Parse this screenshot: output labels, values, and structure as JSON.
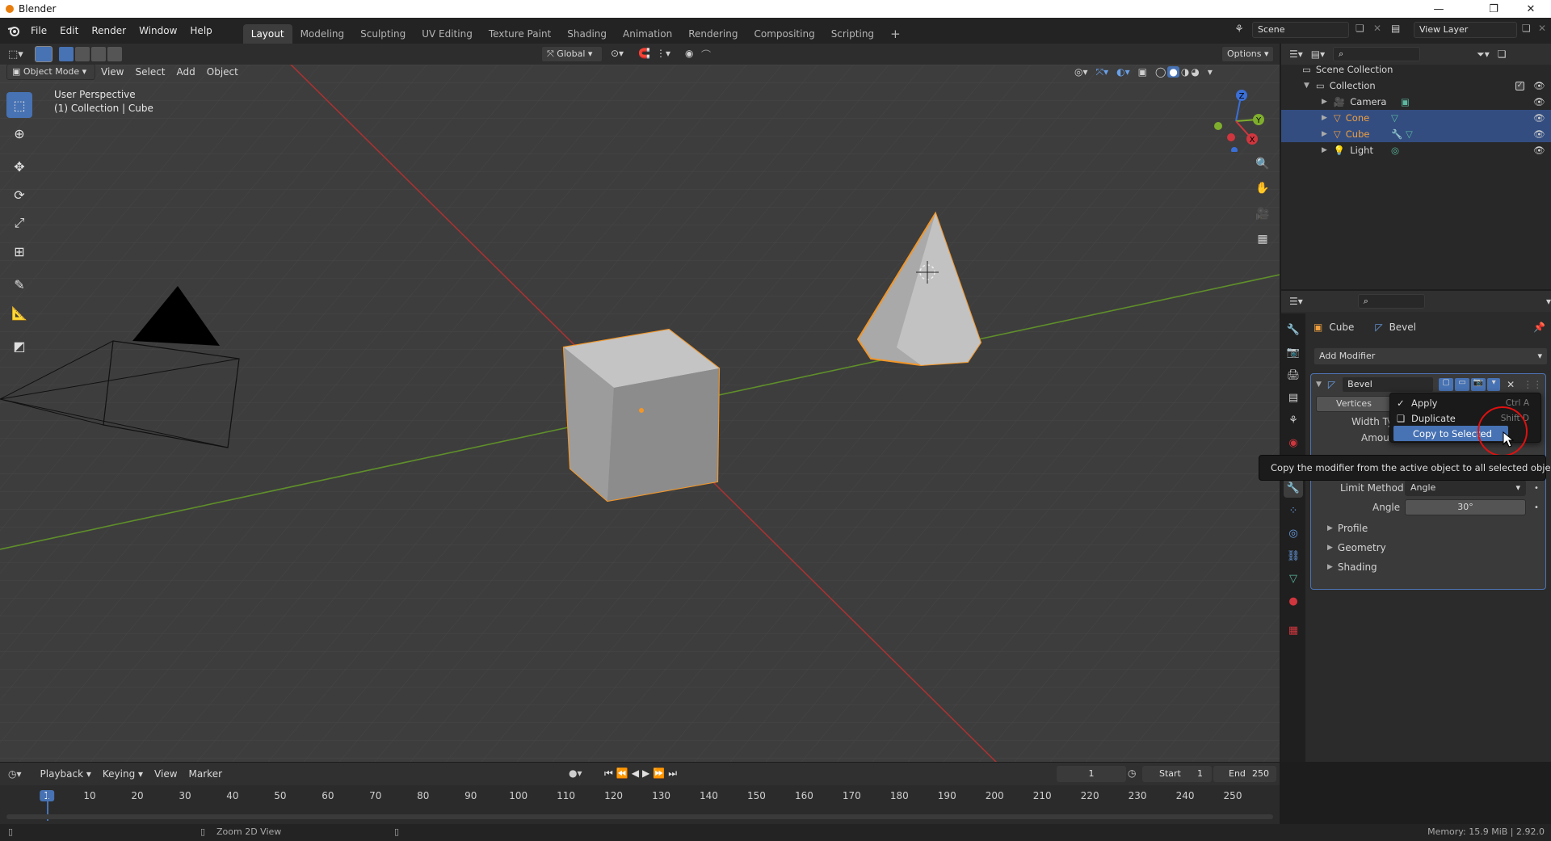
{
  "window": {
    "title": "Blender",
    "minimize": "—",
    "restore": "❐",
    "close": "✕"
  },
  "menus": [
    "File",
    "Edit",
    "Render",
    "Window",
    "Help"
  ],
  "workspaces": {
    "tabs": [
      "Layout",
      "Modeling",
      "Sculpting",
      "UV Editing",
      "Texture Paint",
      "Shading",
      "Animation",
      "Rendering",
      "Compositing",
      "Scripting"
    ],
    "active": "Layout",
    "add_symbol": "+"
  },
  "scene": {
    "name": "Scene",
    "view_layer": "View Layer"
  },
  "viewport_header": {
    "transform_orientation": "Global",
    "options_label": "Options",
    "mode": "Object Mode",
    "menus": [
      "View",
      "Select",
      "Add",
      "Object"
    ]
  },
  "viewport": {
    "perspective_label": "User Perspective",
    "collection_label": "(1) Collection | Cube",
    "gizmo": {
      "x": "X",
      "y": "Y",
      "z": "Z"
    }
  },
  "outliner": {
    "root": "Scene Collection",
    "collection": "Collection",
    "items": [
      {
        "name": "Camera",
        "color": "#d8d8d8",
        "selected": false
      },
      {
        "name": "Cone",
        "color": "#f0a040",
        "selected": true
      },
      {
        "name": "Cube",
        "color": "#f0a040",
        "selected": true
      },
      {
        "name": "Light",
        "color": "#d8d8d8",
        "selected": false
      }
    ]
  },
  "properties": {
    "breadcrumb_object": "Cube",
    "breadcrumb_modifier": "Bevel",
    "add_modifier_label": "Add Modifier",
    "modifier": {
      "name": "Bevel",
      "affect_vertices": "Vertices",
      "width_type_label": "Width Typ",
      "amount_label": "Amoun",
      "limit_method_label": "Limit Method",
      "limit_method_value": "Angle",
      "angle_label": "Angle",
      "angle_value": "30°",
      "subpanels": [
        "Profile",
        "Geometry",
        "Shading"
      ]
    }
  },
  "context_menu": {
    "items": [
      {
        "label": "Apply",
        "shortcut": "Ctrl A"
      },
      {
        "label": "Duplicate",
        "shortcut": "Shift D"
      },
      {
        "label": "Copy to Selected",
        "shortcut": ""
      }
    ],
    "highlighted": "Copy to Selected"
  },
  "tooltip": "Copy the modifier from the active object to all selected objects.",
  "timeline": {
    "menus": [
      "Playback",
      "Keying",
      "View",
      "Marker"
    ],
    "current_frame": "1",
    "start_label": "Start",
    "start_value": "1",
    "end_label": "End",
    "end_value": "250",
    "ticks": [
      "1",
      "10",
      "20",
      "30",
      "40",
      "50",
      "60",
      "70",
      "80",
      "90",
      "100",
      "110",
      "120",
      "130",
      "140",
      "150",
      "160",
      "170",
      "180",
      "190",
      "200",
      "210",
      "220",
      "230",
      "240",
      "250"
    ]
  },
  "statusbar": {
    "hint": "Zoom 2D View",
    "memory": "Memory: 15.9 MiB | 2.92.0"
  },
  "colors": {
    "accent": "#4772b3",
    "selected_outline": "#f29628",
    "x_axis": "#c83c3c",
    "y_axis": "#6c9c30",
    "annotation_circle": "#e01010"
  }
}
